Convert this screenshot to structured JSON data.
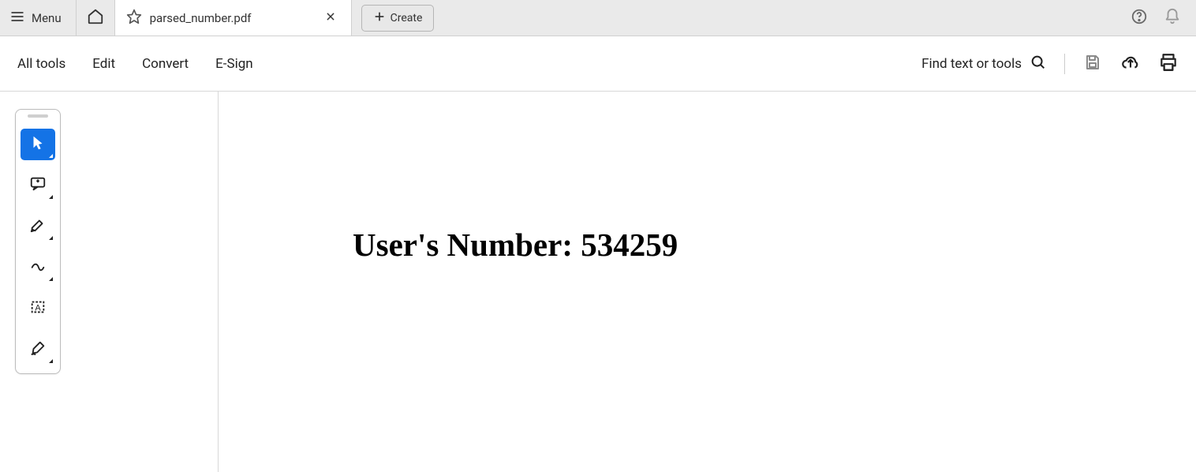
{
  "tabbar": {
    "menu_label": "Menu",
    "tab_title": "parsed_number.pdf",
    "create_label": "Create"
  },
  "toolbar": {
    "items": [
      "All tools",
      "Edit",
      "Convert",
      "E-Sign"
    ],
    "find_label": "Find text or tools"
  },
  "document": {
    "content": "User's Number: 534259"
  }
}
